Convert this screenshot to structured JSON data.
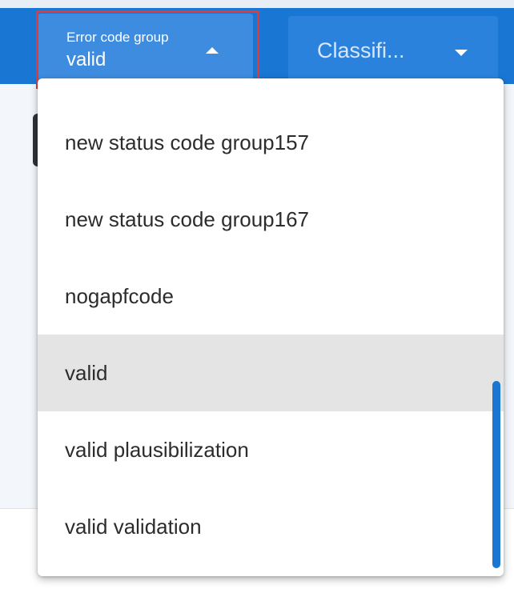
{
  "toolbar": {
    "error_code_group": {
      "label": "Error code group",
      "value": "valid"
    },
    "classification": {
      "value": "Classifi..."
    }
  },
  "dropdown": {
    "options": [
      {
        "label": "new status code group157",
        "selected": false
      },
      {
        "label": "new status code group167",
        "selected": false
      },
      {
        "label": "nogapfcode",
        "selected": false
      },
      {
        "label": "valid",
        "selected": true
      },
      {
        "label": "valid plausibilization",
        "selected": false
      },
      {
        "label": "valid validation",
        "selected": false
      }
    ]
  },
  "colors": {
    "toolbar": "#1976d2",
    "highlight": "#e53935",
    "selected_option": "#e4e4e4",
    "scrollbar": "#1976d2"
  },
  "icons": [
    "caret-up-icon",
    "caret-down-icon"
  ]
}
